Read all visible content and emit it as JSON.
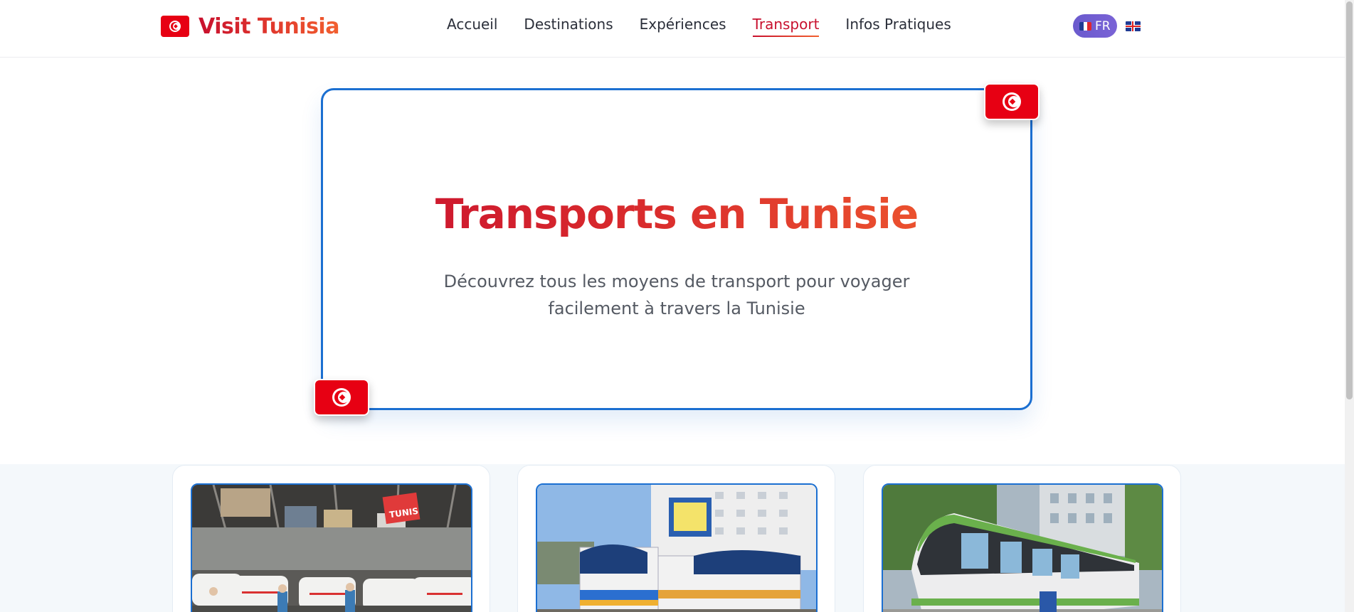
{
  "header": {
    "brand": "Visit Tunisia",
    "nav": [
      {
        "label": "Accueil",
        "active": false
      },
      {
        "label": "Destinations",
        "active": false
      },
      {
        "label": "Expériences",
        "active": false
      },
      {
        "label": "Transport",
        "active": true
      },
      {
        "label": "Infos Pratiques",
        "active": false
      }
    ],
    "lang_active": "FR",
    "lang_other_icon": "uk-flag-icon"
  },
  "hero": {
    "title": "Transports en Tunisie",
    "subtitle": "Découvrez tous les moyens de transport pour voyager facilement à travers la Tunisie"
  },
  "cards": [
    {
      "image": "louage-station-photo",
      "sign": "TUNIS"
    },
    {
      "image": "train-station-photo"
    },
    {
      "image": "tramway-photo"
    }
  ],
  "colors": {
    "brand_red": "#c8102e",
    "brand_orange": "#f2602f",
    "accent_blue": "#1b6fd1",
    "lang_pill": "#6a5acd",
    "flag_red": "#e70013"
  }
}
